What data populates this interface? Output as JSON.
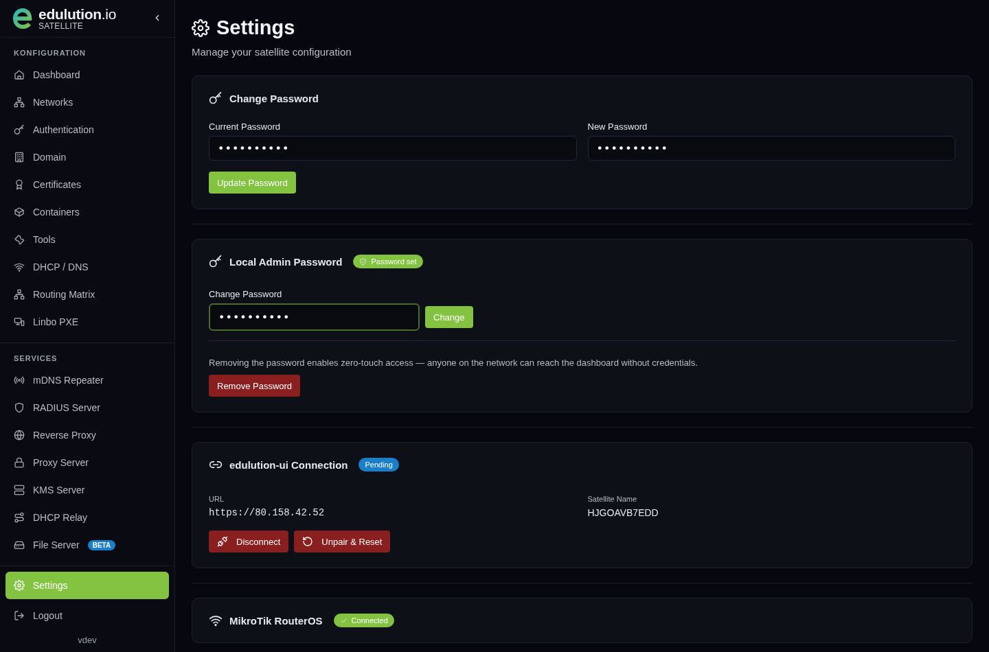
{
  "sidebar": {
    "brand": {
      "name": "edulution",
      "suffix": ".io",
      "subtitle": "SATELLITE"
    },
    "sections": [
      {
        "title": "KONFIGURATION",
        "items": [
          {
            "label": "Dashboard",
            "selected": false
          },
          {
            "label": "Networks",
            "selected": false
          },
          {
            "label": "Authentication",
            "selected": false
          },
          {
            "label": "Domain",
            "selected": false
          },
          {
            "label": "Certificates",
            "selected": false
          },
          {
            "label": "Containers",
            "selected": false
          },
          {
            "label": "Tools",
            "selected": false
          },
          {
            "label": "DHCP / DNS",
            "selected": false
          },
          {
            "label": "Routing Matrix",
            "selected": false
          },
          {
            "label": "Linbo PXE",
            "selected": false
          }
        ]
      },
      {
        "title": "SERVICES",
        "items": [
          {
            "label": "mDNS Repeater",
            "selected": false
          },
          {
            "label": "RADIUS Server",
            "selected": false
          },
          {
            "label": "Reverse Proxy",
            "selected": false
          },
          {
            "label": "Proxy Server",
            "selected": false
          },
          {
            "label": "KMS Server",
            "selected": false
          },
          {
            "label": "DHCP Relay",
            "selected": false
          },
          {
            "label": "File Server",
            "selected": false,
            "badge": "BETA"
          }
        ]
      }
    ],
    "footer_items": [
      {
        "label": "Settings",
        "selected": true
      },
      {
        "label": "Logout",
        "selected": false
      }
    ],
    "version": "vdev"
  },
  "header": {
    "title": "Settings",
    "subtitle": "Manage your satellite configuration"
  },
  "cards": [
    {
      "kind": "change-password",
      "title": "Change Password",
      "fields": [
        {
          "label": "Current Password",
          "value": "••••••••••",
          "focused": false
        },
        {
          "label": "New Password",
          "value": "••••••••••",
          "focused": false
        }
      ],
      "button": "Update Password"
    },
    {
      "kind": "local-admin",
      "title": "Local Admin Password",
      "badge": {
        "text": "Password set",
        "color": "#84c241"
      },
      "field": {
        "label": "Change Password",
        "value": "••••••••••",
        "focused": true
      },
      "change_button": "Change",
      "note": "Removing the password enables zero-touch access — anyone on the network can reach the dashboard without credentials.",
      "remove_button": "Remove Password"
    },
    {
      "kind": "connection",
      "title": "edulution-ui Connection",
      "badge": {
        "text": "Pending",
        "color": "#1a7fc8"
      },
      "info": [
        {
          "label": "URL",
          "value": "https://80.158.42.52",
          "mono": true
        },
        {
          "label": "Satellite Name",
          "value": "HJGOAVB7EDD",
          "mono": false
        }
      ],
      "buttons": [
        "Disconnect",
        "Unpair & Reset"
      ]
    },
    {
      "kind": "router",
      "title": "MikroTik RouterOS",
      "badge": {
        "text": "Connected",
        "color": "#84c241"
      }
    }
  ]
}
